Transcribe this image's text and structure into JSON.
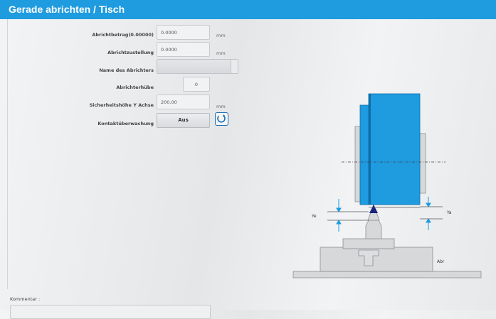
{
  "window": {
    "title": "Gerade abrichten / Tisch"
  },
  "form": {
    "dressing_amount": {
      "label": "Abrichtbetrag(0.00000)",
      "value": "0.0000",
      "unit": "mm"
    },
    "dressing_infeed": {
      "label": "Abrichtzustellung",
      "value": "0.0000",
      "unit": "mm"
    },
    "dresser_name": {
      "label": "Name des Abrichters",
      "value": ""
    },
    "dressing_stroke": {
      "label": "Abrichterhübe",
      "value": "0"
    },
    "safety_height": {
      "label": "Sicherheitshöhe Y Achse",
      "value": "200.00",
      "unit": "mm"
    },
    "contact_monitoring": {
      "label": "Kontaktüberwachung",
      "value": "Aus"
    }
  },
  "comment": {
    "label": "Kommentar :",
    "value": ""
  },
  "diagram": {
    "label_left": "Ye",
    "label_right": "Ya",
    "label_base": "Abr",
    "colors": {
      "wheel": "#1f9be0",
      "tip": "#1a237e",
      "arrow": "#1f9be0",
      "machine": "#d6d8da"
    }
  },
  "icons": {
    "refresh": "refresh-icon"
  }
}
